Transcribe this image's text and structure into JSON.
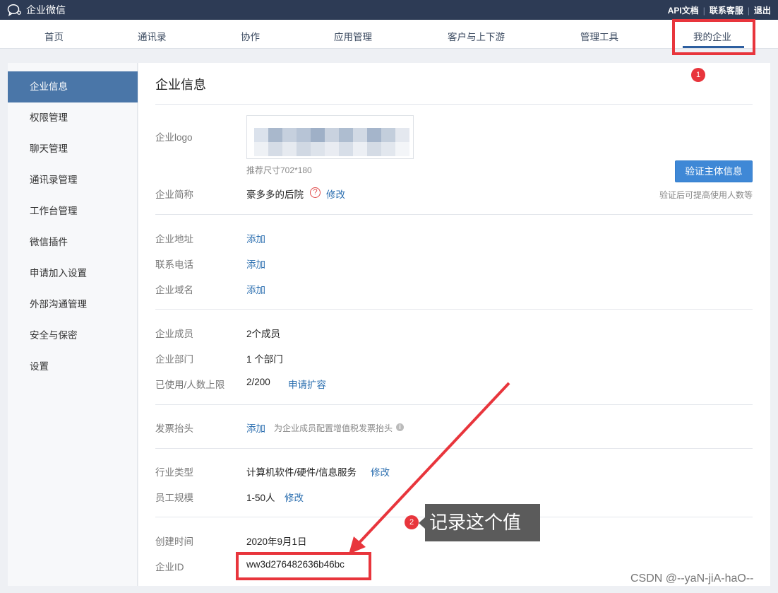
{
  "topbar": {
    "brand": "企业微信",
    "links": [
      "API文档",
      "联系客服",
      "退出"
    ]
  },
  "nav": {
    "items": [
      "首页",
      "通讯录",
      "协作",
      "应用管理",
      "客户与上下游",
      "管理工具",
      "我的企业"
    ],
    "active": "我的企业"
  },
  "sidebar": {
    "items": [
      "企业信息",
      "权限管理",
      "聊天管理",
      "通讯录管理",
      "工作台管理",
      "微信插件",
      "申请加入设置",
      "外部沟通管理",
      "安全与保密",
      "设置"
    ],
    "active": "企业信息"
  },
  "main": {
    "title": "企业信息",
    "logo": {
      "label": "企业logo",
      "hint": "推荐尺寸702*180"
    },
    "verify": {
      "button": "验证主体信息",
      "hint": "验证后可提高使用人数等"
    },
    "short_name": {
      "label": "企业简称",
      "value": "豪多多的后院",
      "help": "?",
      "edit": "修改"
    },
    "address": {
      "label": "企业地址",
      "action": "添加"
    },
    "phone": {
      "label": "联系电话",
      "action": "添加"
    },
    "domain": {
      "label": "企业域名",
      "action": "添加"
    },
    "members": {
      "label": "企业成员",
      "value": "2个成员"
    },
    "departments": {
      "label": "企业部门",
      "value": "1 个部门"
    },
    "usage": {
      "label": "已使用/人数上限",
      "value": "2/200",
      "action": "申请扩容"
    },
    "invoice": {
      "label": "发票抬头",
      "action": "添加",
      "hint": "为企业成员配置增值税发票抬头",
      "info": "i"
    },
    "industry": {
      "label": "行业类型",
      "value": "计算机软件/硬件/信息服务",
      "edit": "修改"
    },
    "scale": {
      "label": "员工规模",
      "value": "1-50人",
      "edit": "修改"
    },
    "created": {
      "label": "创建时间",
      "value": "2020年9月1日"
    },
    "corp_id": {
      "label": "企业ID",
      "value": "ww3d276482636b46bc"
    }
  },
  "annotations": {
    "badge1": "1",
    "badge2": "2",
    "note": "记录这个值",
    "accent": "#e8353c"
  },
  "watermark": "CSDN @--yaN-jiA-haO--"
}
